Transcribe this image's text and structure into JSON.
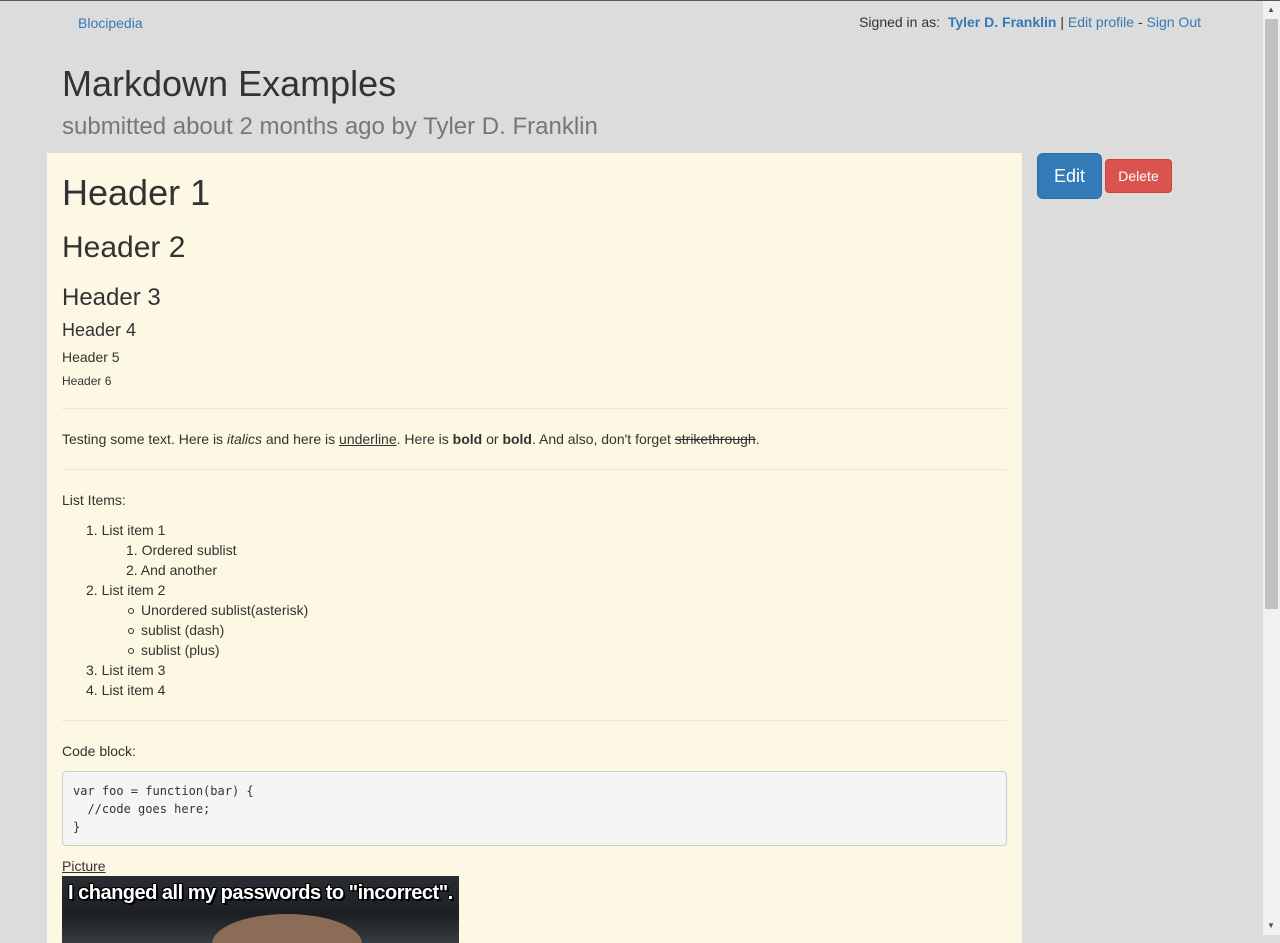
{
  "nav": {
    "brand": "Blocipedia",
    "signed_in_label": "Signed in as:",
    "user_name": "Tyler D. Franklin",
    "separator1": "|",
    "edit_profile": "Edit profile",
    "separator2": "-",
    "sign_out": "Sign Out"
  },
  "wiki": {
    "title": "Markdown Examples",
    "subtitle": "submitted about 2 months ago by Tyler D. Franklin"
  },
  "actions": {
    "edit": "Edit",
    "delete": "Delete"
  },
  "body": {
    "h1": "Header 1",
    "h2": "Header 2",
    "h3": "Header 3",
    "h4": "Header 4",
    "h5": "Header 5",
    "h6": "Header 6",
    "text": {
      "t1": "Testing some text. Here is ",
      "italics": "italics",
      "t2": " and here is ",
      "underline": "underline",
      "t3": ". Here is ",
      "bold1": "bold",
      "t4": " or ",
      "bold2": "bold",
      "t5": ". And also, don't forget ",
      "strike": "strikethrough",
      "t6": "."
    },
    "list_label": "List Items:",
    "list": {
      "item1": "1. List item 1",
      "sub1a": "1. Ordered sublist",
      "sub1b": "2. And another",
      "item2": "2. List item 2",
      "sub2a": "Unordered sublist(asterisk)",
      "sub2b": "sublist (dash)",
      "sub2c": "sublist (plus)",
      "item3": "3. List item 3",
      "item4": "4. List item 4"
    },
    "code_label": "Code block:",
    "code": "var foo = function(bar) {\n  //code goes here;\n}",
    "picture_link": "Picture",
    "meme_caption": "I changed all my passwords to \"incorrect\"."
  },
  "colors": {
    "page_bg": "#dcdcdc",
    "content_bg": "#fcf8e3",
    "link": "#337ab7",
    "edit_button": "#337ab7",
    "delete_button": "#d9534f"
  }
}
